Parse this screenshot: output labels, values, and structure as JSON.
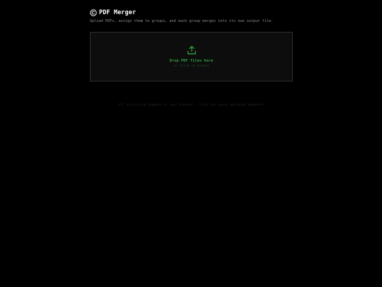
{
  "header": {
    "logo_icon": "copyright-logo-icon",
    "title": "PDF Merger",
    "subtitle": "Upload PDFs, assign them to groups, and each group merges into its own output file."
  },
  "dropzone": {
    "icon": "upload-icon",
    "label": "Drop PDF files here",
    "sublabel": "or click to browse"
  },
  "footer": {
    "note": "All processing happens in your browser · files are never uploaded anywhere"
  },
  "colors": {
    "background": "#000000",
    "accent": "#2f9a3a",
    "title": "#ffffff",
    "muted": "#8a8a8a"
  }
}
